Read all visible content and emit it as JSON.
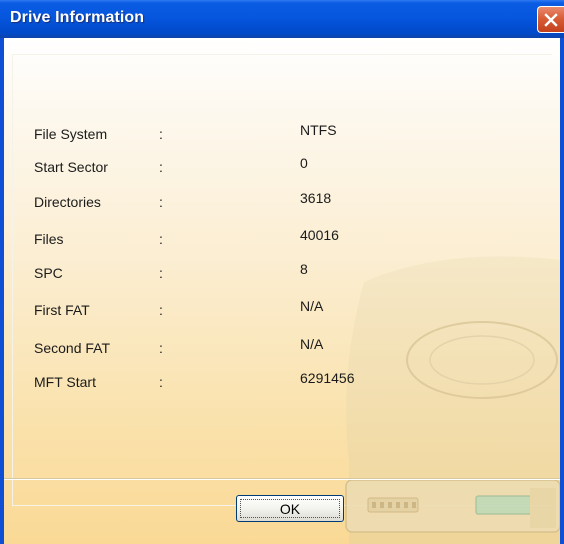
{
  "window": {
    "title": "Drive Information"
  },
  "icons": {
    "close": "close-icon",
    "background": "hard-drive-icon"
  },
  "colors": {
    "titlebar": "#0656de",
    "close_button": "#d85e37",
    "client_top": "#ffffff",
    "client_bottom": "#fad995",
    "text": "#1b1b1b"
  },
  "info": [
    {
      "label": "File System",
      "colon": ":",
      "value": "NTFS"
    },
    {
      "label": "Start Sector",
      "colon": ":",
      "value": "0"
    },
    {
      "label": "Directories",
      "colon": ":",
      "value": "3618"
    },
    {
      "label": "Files",
      "colon": ":",
      "value": "40016"
    },
    {
      "label": "SPC",
      "colon": ":",
      "value": "8"
    },
    {
      "label": "First FAT",
      "colon": ":",
      "value": "N/A"
    },
    {
      "label": "Second FAT",
      "colon": ":",
      "value": "N/A"
    },
    {
      "label": "MFT Start",
      "colon": ":",
      "value": "6291456"
    }
  ],
  "buttons": {
    "ok_label": "OK"
  }
}
